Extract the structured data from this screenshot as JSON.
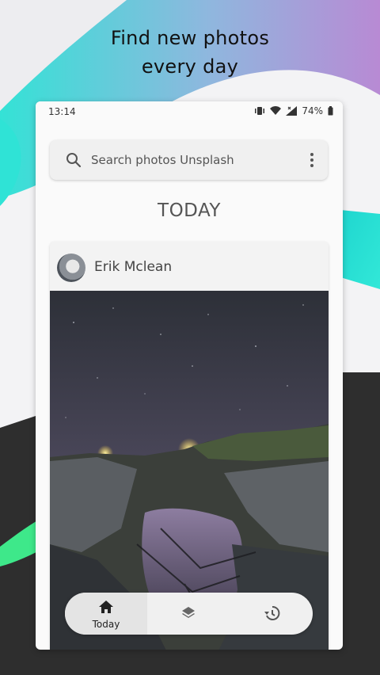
{
  "promo": {
    "line1": "Find new photos",
    "line2": "every day"
  },
  "statusbar": {
    "time": "13:14",
    "battery": "74%",
    "icons": [
      "vibrate-icon",
      "wifi-icon",
      "signal-icon",
      "battery-icon"
    ]
  },
  "search": {
    "placeholder": "Search photos Unsplash",
    "icon": "search-icon",
    "menu_icon": "more-vert-icon"
  },
  "section_title": "TODAY",
  "card": {
    "author": "Erik Mclean",
    "photo": "night sky over rocky coastline with lights"
  },
  "bottom_nav": {
    "items": [
      {
        "label": "Today",
        "icon": "home-icon",
        "active": true
      },
      {
        "label": "",
        "icon": "layers-icon",
        "active": false
      },
      {
        "label": "",
        "icon": "history-icon",
        "active": false
      }
    ]
  },
  "colors": {
    "teal": "#2ee6d6",
    "purple": "#b48ad6",
    "dark": "#2f2f2f",
    "green": "#3ee88a"
  }
}
